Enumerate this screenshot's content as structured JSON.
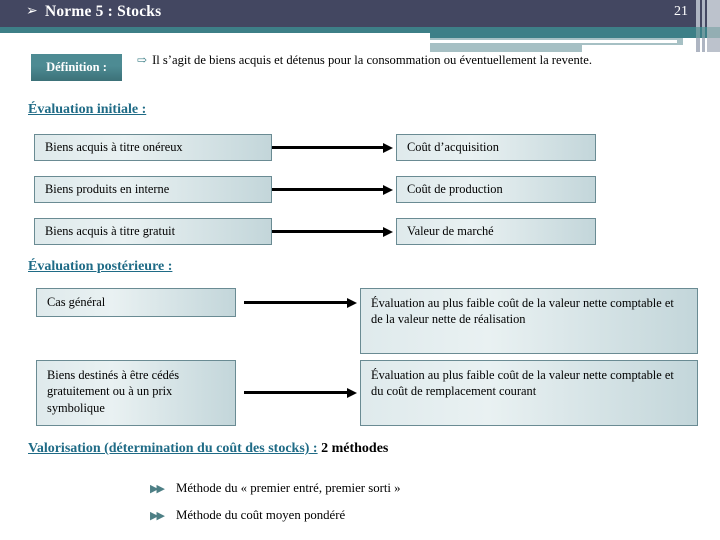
{
  "header": {
    "bullet_icon": "➢",
    "title": "Norme 5 :  Stocks",
    "page_number": "21"
  },
  "definition": {
    "badge_label": "Définition :",
    "arrow_icon": "⇨",
    "text": "Il s’agit de biens acquis et détenus pour la consommation ou éventuellement la revente."
  },
  "sections": [
    {
      "title": "Évaluation initiale :",
      "rows": [
        {
          "left": "Biens acquis à titre onéreux",
          "right": "Coût d’acquisition"
        },
        {
          "left": "Biens produits en interne",
          "right": "Coût de production"
        },
        {
          "left": "Biens acquis à titre gratuit",
          "right": "Valeur de marché"
        }
      ]
    },
    {
      "title": "Évaluation postérieure :",
      "rows": [
        {
          "left": "Cas général",
          "right": "Évaluation au plus faible coût de la valeur nette comptable et de la valeur nette de réalisation"
        },
        {
          "left": "Biens destinés à être cédés gratuitement ou à un prix symbolique",
          "right": "Évaluation au plus faible coût de la valeur nette comptable et du coût de remplacement courant"
        }
      ]
    }
  ],
  "valorisation": {
    "link_text": "Valorisation (détermination du coût des stocks) :",
    "tail_text": "2 méthodes",
    "bullet_icon": "▶▶",
    "methods": [
      "Méthode du « premier entré, premier sorti »",
      "Méthode du coût moyen pondéré"
    ]
  },
  "colors": {
    "header_bg": "#434761",
    "band_teal": "#3d7f87",
    "band_pale": "#a6c0c4",
    "badge_teal": "#4d8b93",
    "heading_teal": "#1f6b86",
    "box_border": "#6a8b93",
    "arrow_black": "#000000"
  }
}
